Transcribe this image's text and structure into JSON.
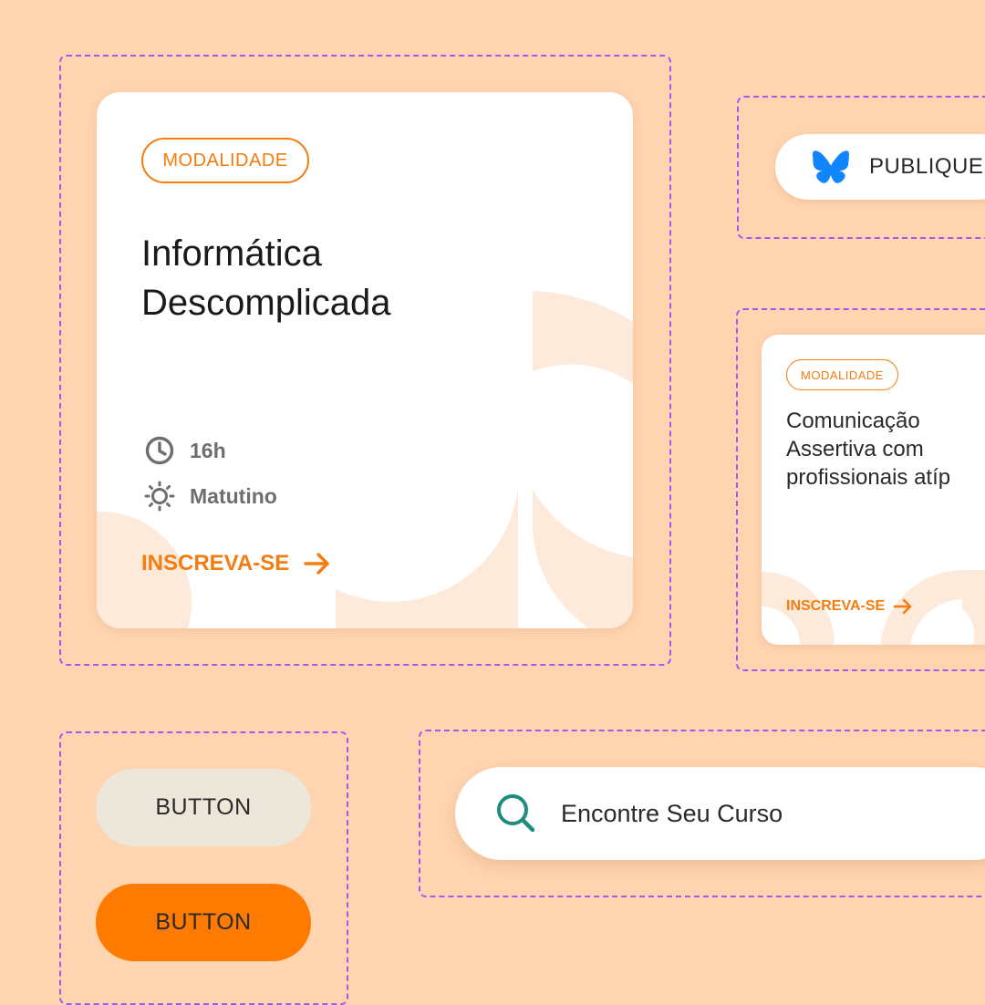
{
  "colors": {
    "background": "#FFD4B0",
    "frame_border": "#9B5CF0",
    "accent": "#F57C0E",
    "deco": "#FDEADA",
    "search_icon": "#1E8C7E",
    "bluesky": "#1185FE",
    "button_secondary": "#EDE6DA",
    "button_primary": "#FF7A00"
  },
  "course_card_large": {
    "tag": "MODALIDADE",
    "title_line1": "Informática",
    "title_line2": "Descomplicada",
    "duration": "16h",
    "duration_icon": "clock-icon",
    "shift": "Matutino",
    "shift_icon": "sun-icon",
    "cta": "INSCREVA-SE",
    "cta_icon": "arrow-right-icon"
  },
  "share_button": {
    "icon": "bluesky-butterfly-icon",
    "label": "PUBLIQUE"
  },
  "course_card_small": {
    "tag": "MODALIDADE",
    "title_line1": "Comunicação",
    "title_line2": "Assertiva com",
    "title_line3": "profissionais atíp",
    "cta": "INSCREVA-SE",
    "cta_icon": "arrow-right-icon"
  },
  "buttons": {
    "secondary_label": "BUTTON",
    "primary_label": "BUTTON"
  },
  "search": {
    "icon": "search-icon",
    "label": "Encontre Seu Curso"
  }
}
